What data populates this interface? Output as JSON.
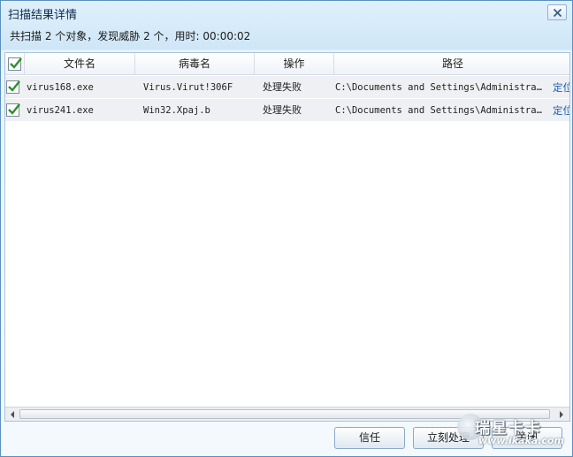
{
  "window": {
    "title": "扫描结果详情",
    "summary": "共扫描 2 个对象，发现威胁 2 个，用时: 00:00:02"
  },
  "table": {
    "columns": [
      "文件名",
      "病毒名",
      "操作",
      "路径"
    ],
    "select_all_checked": true,
    "rows": [
      {
        "checked": true,
        "file": "virus168.exe",
        "virus": "Virus.Virut!306F",
        "action": "处理失败",
        "path": "C:\\Documents  and Settings\\Administra…",
        "locate": "定位"
      },
      {
        "checked": true,
        "file": "virus241.exe",
        "virus": "Win32.Xpaj.b",
        "action": "处理失败",
        "path": "C:\\Documents  and Settings\\Administra…",
        "locate": "定位"
      }
    ]
  },
  "buttons": {
    "trust": "信任",
    "process_now": "立刻处理",
    "close": "关闭"
  },
  "watermark": {
    "text": "瑞星卡卡",
    "url": "www.ikaka.com"
  },
  "icons": {
    "close": "close-icon",
    "check": "checkmark-icon",
    "scroll_left": "arrow-left-icon",
    "scroll_right": "arrow-right-icon"
  },
  "colors": {
    "accent": "#1a5fb4",
    "check_green": "#2f8f2f",
    "row_bg": "#eef0f3"
  }
}
